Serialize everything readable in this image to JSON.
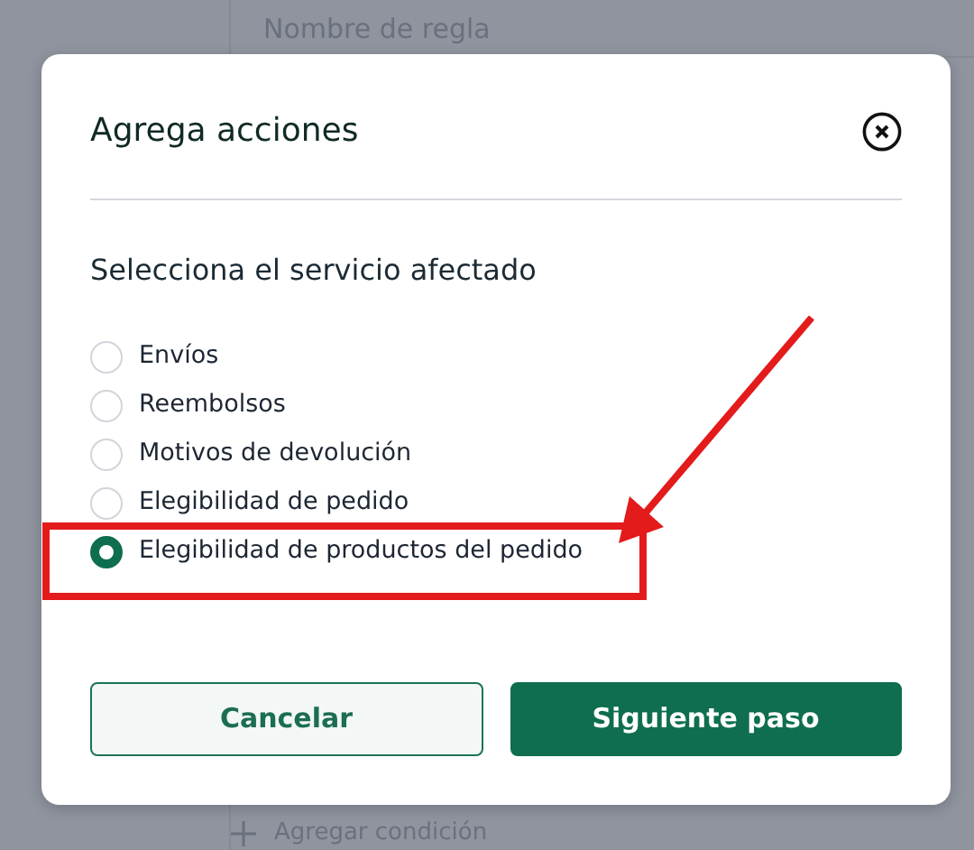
{
  "background": {
    "column_header": "Nombre de regla",
    "add_condition": "Agregar condición"
  },
  "dialog": {
    "title": "Agrega acciones",
    "subtitle": "Selecciona el servicio afectado",
    "options": [
      {
        "label": "Envíos",
        "selected": false
      },
      {
        "label": "Reembolsos",
        "selected": false
      },
      {
        "label": "Motivos de devolución",
        "selected": false
      },
      {
        "label": "Elegibilidad de pedido",
        "selected": false
      },
      {
        "label": "Elegibilidad de productos del pedido",
        "selected": true
      }
    ],
    "buttons": [
      {
        "label": "Cancelar",
        "kind": "secondary"
      },
      {
        "label": "Siguiente paso",
        "kind": "primary"
      }
    ]
  }
}
